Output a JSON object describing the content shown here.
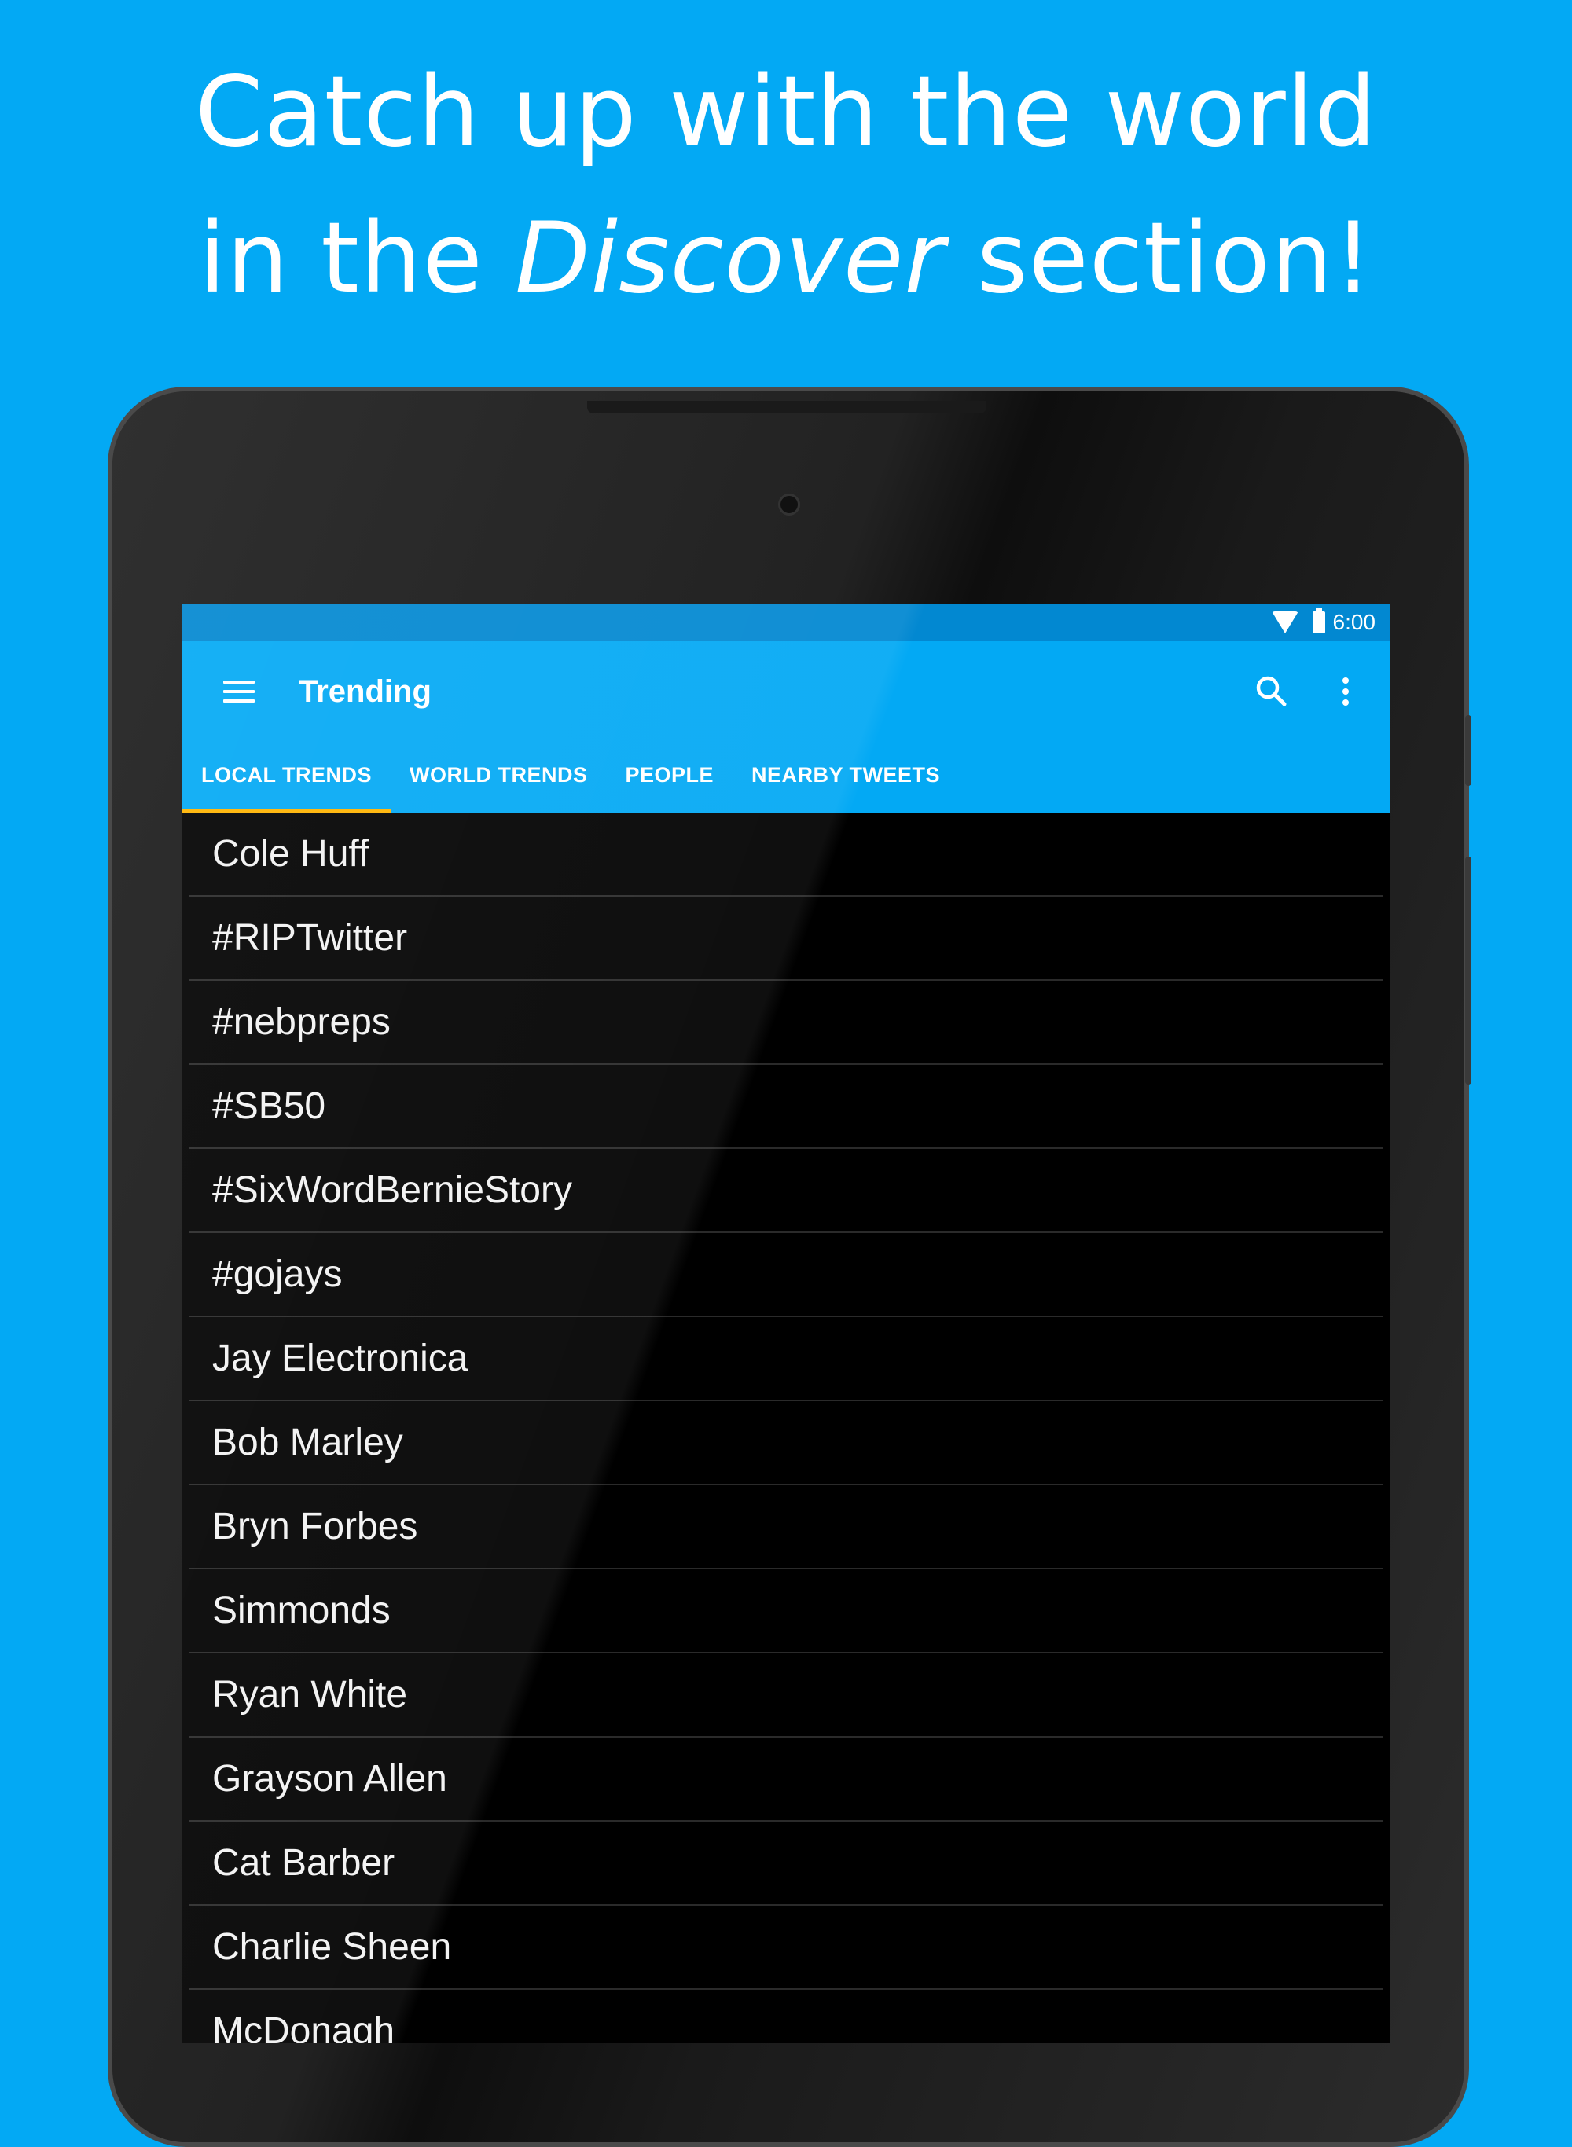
{
  "headline": {
    "line1": "Catch up with the world",
    "line2_prefix": "in the ",
    "line2_emphasis": "Discover",
    "line2_suffix": " section!"
  },
  "statusbar": {
    "time": "6:00",
    "icons": [
      "wifi-icon",
      "battery-icon"
    ]
  },
  "toolbar": {
    "title": "Trending",
    "icons": [
      "menu-icon",
      "search-icon",
      "more-vert-icon"
    ]
  },
  "tabs": [
    {
      "label": "LOCAL TRENDS",
      "active": true
    },
    {
      "label": "WORLD TRENDS",
      "active": false
    },
    {
      "label": "PEOPLE",
      "active": false
    },
    {
      "label": "NEARBY TWEETS",
      "active": false
    }
  ],
  "trends": [
    "Cole Huff",
    "#RIPTwitter",
    "#nebpreps",
    "#SB50",
    "#SixWordBernieStory",
    "#gojays",
    "Jay Electronica",
    "Bob Marley",
    "Bryn Forbes",
    "Simmonds",
    "Ryan White",
    "Grayson Allen",
    "Cat Barber",
    "Charlie Sheen",
    "McDonagh"
  ],
  "colors": {
    "background": "#03a9f4",
    "statusbar": "#0288d1",
    "toolbar": "#03a9f4",
    "tab_indicator": "#ffb300",
    "list_background": "#000000",
    "list_text": "#f2f2f2"
  }
}
